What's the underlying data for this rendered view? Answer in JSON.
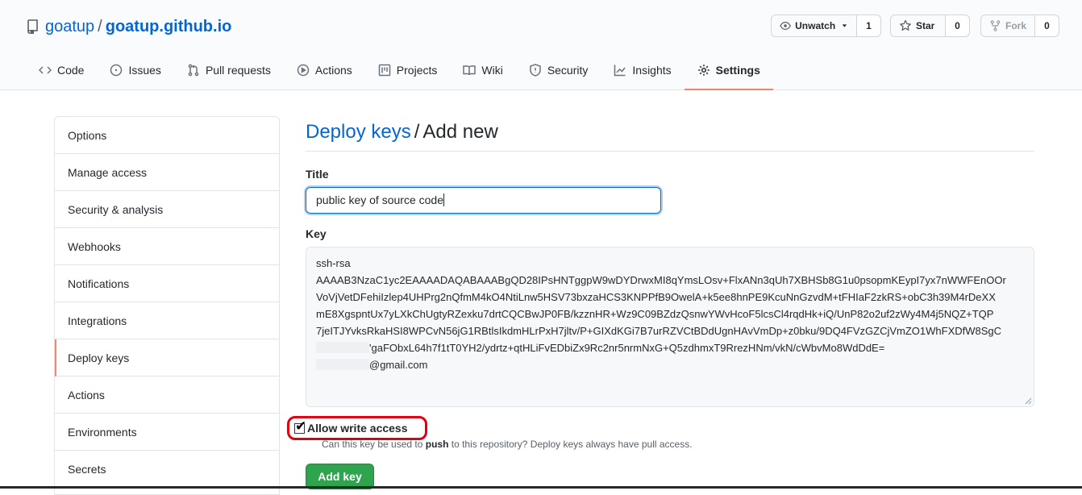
{
  "repo": {
    "owner": "goatup",
    "separator": "/",
    "name": "goatup.github.io"
  },
  "actions": {
    "watch": {
      "label": "Unwatch",
      "count": "1"
    },
    "star": {
      "label": "Star",
      "count": "0"
    },
    "fork": {
      "label": "Fork",
      "count": "0"
    }
  },
  "tabs": [
    {
      "label": "Code",
      "icon": "code-icon"
    },
    {
      "label": "Issues",
      "icon": "issue-icon"
    },
    {
      "label": "Pull requests",
      "icon": "pull-request-icon"
    },
    {
      "label": "Actions",
      "icon": "play-icon"
    },
    {
      "label": "Projects",
      "icon": "project-icon"
    },
    {
      "label": "Wiki",
      "icon": "book-icon"
    },
    {
      "label": "Security",
      "icon": "shield-icon"
    },
    {
      "label": "Insights",
      "icon": "graph-icon"
    },
    {
      "label": "Settings",
      "icon": "gear-icon",
      "selected": true
    }
  ],
  "sidebar": {
    "items": [
      {
        "label": "Options"
      },
      {
        "label": "Manage access"
      },
      {
        "label": "Security & analysis"
      },
      {
        "label": "Webhooks"
      },
      {
        "label": "Notifications"
      },
      {
        "label": "Integrations"
      },
      {
        "label": "Deploy keys",
        "selected": true
      },
      {
        "label": "Actions"
      },
      {
        "label": "Environments"
      },
      {
        "label": "Secrets"
      }
    ]
  },
  "page": {
    "breadcrumb_link": "Deploy keys",
    "breadcrumb_sep": "/",
    "breadcrumb_current": "Add new",
    "title_label": "Title",
    "title_value": "public key of source code",
    "key_label": "Key",
    "key_lines": [
      "ssh-rsa",
      "AAAAB3NzaC1yc2EAAAADAQABAAABgQD28IPsHNTggpW9wDYDrwxMI8qYmsLOsv+FlxANn3qUh7XBHSb8G1u0psopmKEypI7yx7nWWFEnOOr",
      "VoVjVetDFehiIzlep4UHPrg2nQfmM4kO4NtiLnw5HSV73bxzaHCS3KNPPfB9OwelA+k5ee8hnPE9KcuNnGzvdM+tFHIaF2zkRS+obC3h39M4rDeXX",
      "mE8XgspntUx7yLXkChUgtyRZexku7drtCQCBwJP0FB/kzznHR+Wz9C09BZdzQsnwYWvHcoF5lcsCl4rqdHk+iQ/UnP82o2uf2zWy4M4j5NQZ+TQP",
      "7jeITJYvksRkaHSI8WPCvN56jG1RBtlsIkdmHLrPxH7jltv/P+GIXdKGi7B7urRZVCtBDdUgnHAvVmDp+z0bku/9DQ4FVzGZCjVmZO1WhFXDfW8SgC"
    ],
    "key_line_6_tail": "'gaFObxL64h7f1tT0YH2/ydrtz+qtHLiFvEDbiZx9Rc2nr5nrmNxG+Q5zdhmxT9RrezHNm/vkN/cWbvMo8WdDdE=",
    "key_email_tail": "@gmail.com",
    "write_access_label": "Allow write access",
    "write_access_checked": true,
    "hint_pre": "Can this key be used to ",
    "hint_bold": "push",
    "hint_post": " to this repository? Deploy keys always have pull access.",
    "submit_label": "Add key"
  },
  "colors": {
    "link": "#0366d6",
    "accent_tab": "#f9826c",
    "primary_button": "#2ea44f",
    "highlight_ring": "#e0000e"
  }
}
